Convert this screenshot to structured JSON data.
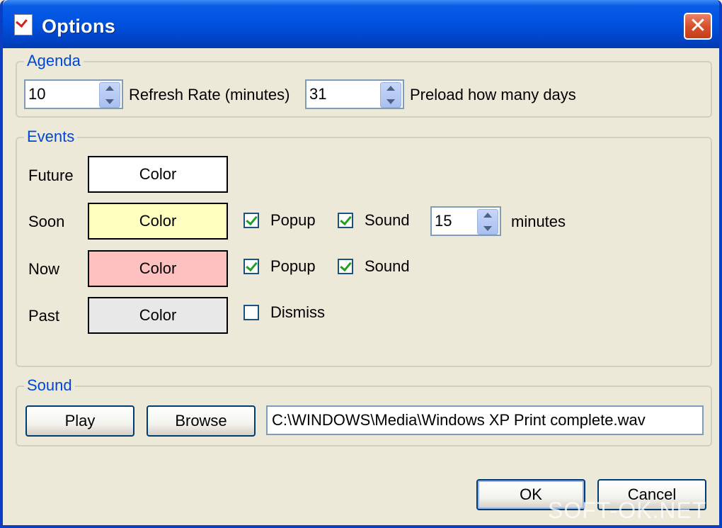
{
  "window": {
    "title": "Options"
  },
  "agenda": {
    "legend": "Agenda",
    "refresh_value": "10",
    "refresh_label": "Refresh Rate (minutes)",
    "preload_value": "31",
    "preload_label": "Preload how many days"
  },
  "events": {
    "legend": "Events",
    "color_label": "Color",
    "rows": [
      {
        "label": "Future",
        "color": "#ffffff"
      },
      {
        "label": "Soon",
        "color": "#ffffc0"
      },
      {
        "label": "Now",
        "color": "#ffc0c0"
      },
      {
        "label": "Past",
        "color": "#e8e8e8"
      }
    ],
    "popup_label": "Popup",
    "sound_label": "Sound",
    "dismiss_label": "Dismiss",
    "soon_minutes_value": "15",
    "minutes_label": "minutes",
    "soon_popup_checked": true,
    "soon_sound_checked": true,
    "now_popup_checked": true,
    "now_sound_checked": true,
    "past_dismiss_checked": false
  },
  "sound": {
    "legend": "Sound",
    "play_label": "Play",
    "browse_label": "Browse",
    "file_path": "C:\\WINDOWS\\Media\\Windows XP Print complete.wav"
  },
  "buttons": {
    "ok_label": "OK",
    "cancel_label": "Cancel"
  },
  "watermark": "SOFT-OK.NET"
}
